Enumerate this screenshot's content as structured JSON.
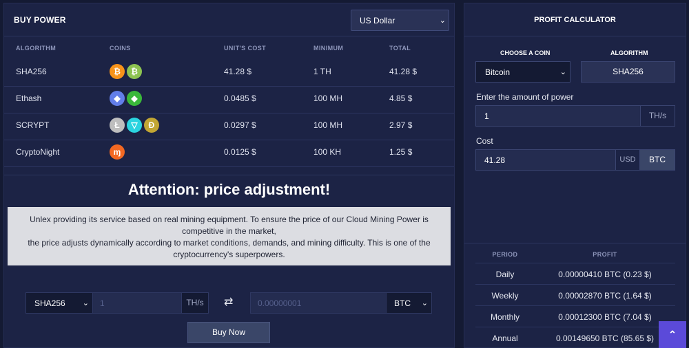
{
  "buy_power": {
    "title": "BUY POWER",
    "currency_selected": "US Dollar",
    "columns": [
      "ALGORITHM",
      "COINS",
      "UNIT'S COST",
      "MINIMUM",
      "TOTAL"
    ],
    "rows": [
      {
        "algorithm": "SHA256",
        "coins": [
          "bitcoin-icon",
          "bitcoin-cash-icon"
        ],
        "unit_cost": "41.28 $",
        "minimum": "1 TH",
        "total": "41.28 $"
      },
      {
        "algorithm": "Ethash",
        "coins": [
          "ethereum-icon",
          "ethereum-classic-icon"
        ],
        "unit_cost": "0.0485 $",
        "minimum": "100 MH",
        "total": "4.85 $"
      },
      {
        "algorithm": "SCRYPT",
        "coins": [
          "litecoin-icon",
          "vertcoin-icon",
          "dogecoin-icon"
        ],
        "unit_cost": "0.0297 $",
        "minimum": "100 MH",
        "total": "2.97 $"
      },
      {
        "algorithm": "CryptoNight",
        "coins": [
          "monero-icon"
        ],
        "unit_cost": "0.0125 $",
        "minimum": "100 KH",
        "total": "1.25 $"
      }
    ],
    "attention_title": "Attention: price adjustment!",
    "notice_line1": "Unlex providing its service based on real mining equipment. To ensure the price of our Cloud Mining Power is competitive in the market,",
    "notice_line2": "the price adjusts dynamically according to market conditions, demands, and mining difficulty. This is one of the cryptocurrency's superpowers.",
    "order": {
      "algorithm_selected": "SHA256",
      "power_placeholder": "1",
      "power_unit": "TH/s",
      "swap_icon": "⇄",
      "btc_placeholder": "0.00000001",
      "currency_selected": "BTC",
      "buy_label": "Buy Now"
    }
  },
  "calculator": {
    "title": "PROFIT CALCULATOR",
    "choose_coin_label": "CHOOSE A COIN",
    "algorithm_label": "ALGORITHM",
    "coin_selected": "Bitcoin",
    "algorithm_value": "SHA256",
    "amount_label": "Enter the amount of power",
    "amount_value": "1",
    "amount_unit": "TH/s",
    "cost_label": "Cost",
    "cost_value": "41.28",
    "usd_label": "USD",
    "btc_label": "BTC",
    "profit_columns": [
      "PERIOD",
      "PROFIT"
    ],
    "profit_rows": [
      {
        "period": "Daily",
        "profit": "0.00000410 BTC (0.23 $)"
      },
      {
        "period": "Weekly",
        "profit": "0.00002870 BTC (1.64 $)"
      },
      {
        "period": "Monthly",
        "profit": "0.00012300 BTC (7.04 $)"
      },
      {
        "period": "Annual",
        "profit": "0.00149650 BTC (85.65 $)"
      }
    ]
  },
  "colors": {
    "bitcoin": "#f7931a",
    "bitcoin_cash": "#8dc351",
    "ethereum": "#627eea",
    "ethereum_classic": "#3ab83a",
    "litecoin": "#bebebe",
    "vertcoin": "#2bd4e0",
    "dogecoin": "#c2a633",
    "monero": "#f26822",
    "accent": "#5b4ad9"
  }
}
